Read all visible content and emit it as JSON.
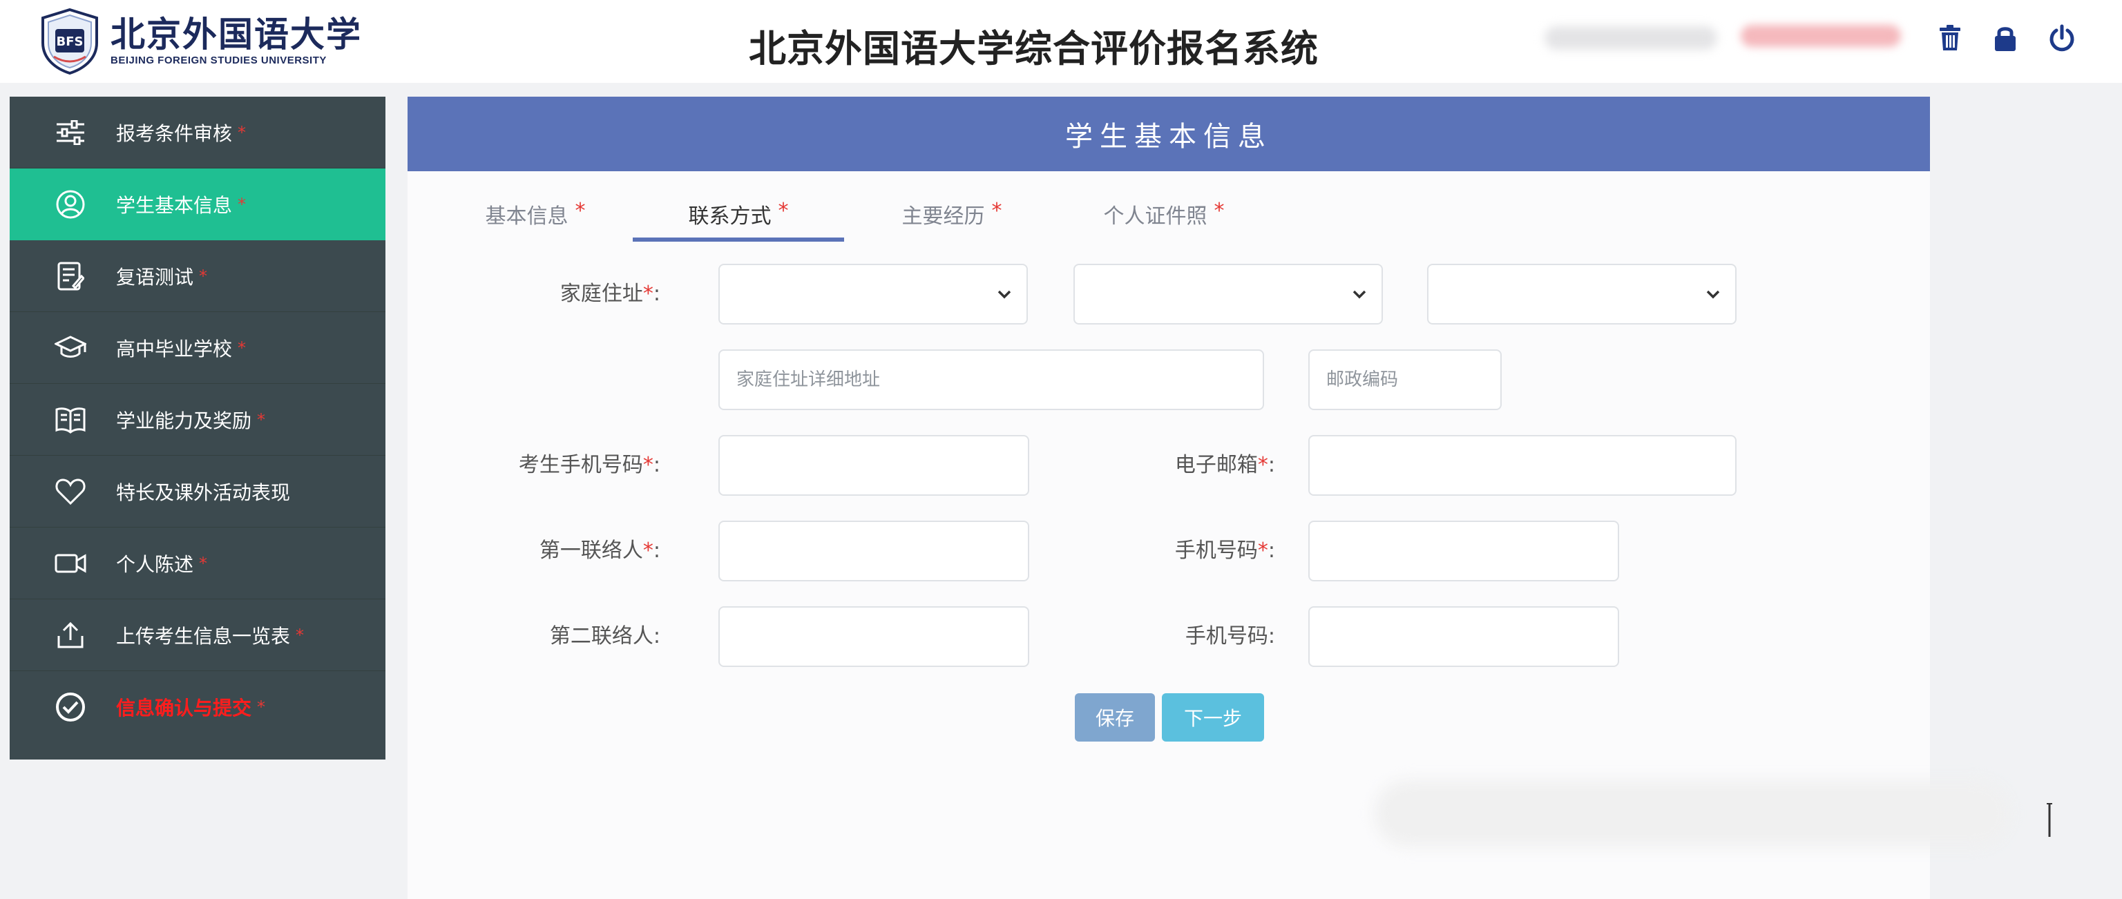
{
  "header": {
    "logo_cn": "北京外国语大学",
    "logo_en": "BEIJING FOREIGN STUDIES UNIVERSITY",
    "title": "北京外国语大学综合评价报名系统",
    "icons": [
      "trash-icon",
      "lock-icon",
      "power-icon"
    ]
  },
  "sidebar": {
    "items": [
      {
        "label": "报考条件审核",
        "icon": "sliders-icon",
        "star": "*"
      },
      {
        "label": "学生基本信息",
        "icon": "user-circle-icon",
        "star": "*",
        "active": true
      },
      {
        "label": "复语测试",
        "icon": "edit-note-icon",
        "star": "*"
      },
      {
        "label": "高中毕业学校",
        "icon": "graduation-cap-icon",
        "star": "*"
      },
      {
        "label": "学业能力及奖励",
        "icon": "book-icon",
        "star": "*"
      },
      {
        "label": "特长及课外活动表现",
        "icon": "heart-icon",
        "star": ""
      },
      {
        "label": "个人陈述",
        "icon": "video-camera-icon",
        "star": "*"
      },
      {
        "label": "上传考生信息一览表",
        "icon": "upload-icon",
        "star": "*"
      },
      {
        "label": "信息确认与提交",
        "icon": "check-circle-icon",
        "star": "*"
      }
    ]
  },
  "panel": {
    "title": "学生基本信息",
    "tabs": [
      {
        "label": "基本信息",
        "star": "*"
      },
      {
        "label": "联系方式",
        "star": "*",
        "active": true
      },
      {
        "label": "主要经历",
        "star": "*"
      },
      {
        "label": "个人证件照",
        "star": "*"
      }
    ]
  },
  "form": {
    "home_address": {
      "label": "家庭住址",
      "req": "*",
      "colon": ":"
    },
    "address_detail": {
      "placeholder": "家庭住址详细地址",
      "value": ""
    },
    "postal_code": {
      "placeholder": "邮政编码",
      "value": ""
    },
    "mobile": {
      "label": "考生手机号码",
      "req": "*",
      "colon": ":",
      "value": ""
    },
    "email": {
      "label": "电子邮箱",
      "req": "*",
      "colon": ":",
      "value": ""
    },
    "contact1": {
      "label": "第一联络人",
      "req": "*",
      "colon": ":",
      "value": ""
    },
    "contact1_phone": {
      "label": "手机号码",
      "req": "*",
      "colon": ":",
      "value": ""
    },
    "contact2": {
      "label": "第二联络人",
      "req": "",
      "colon": ":",
      "value": ""
    },
    "contact2_phone": {
      "label": "手机号码",
      "req": "",
      "colon": ":",
      "value": ""
    }
  },
  "buttons": {
    "save": "保存",
    "next": "下一步"
  },
  "colors": {
    "sidebar_bg": "#3c4a4f",
    "sidebar_active": "#1fbf92",
    "panel_header": "#5b73b8",
    "required_star": "#e53935",
    "save_btn": "#7fa6cf",
    "next_btn": "#5bc0de"
  }
}
